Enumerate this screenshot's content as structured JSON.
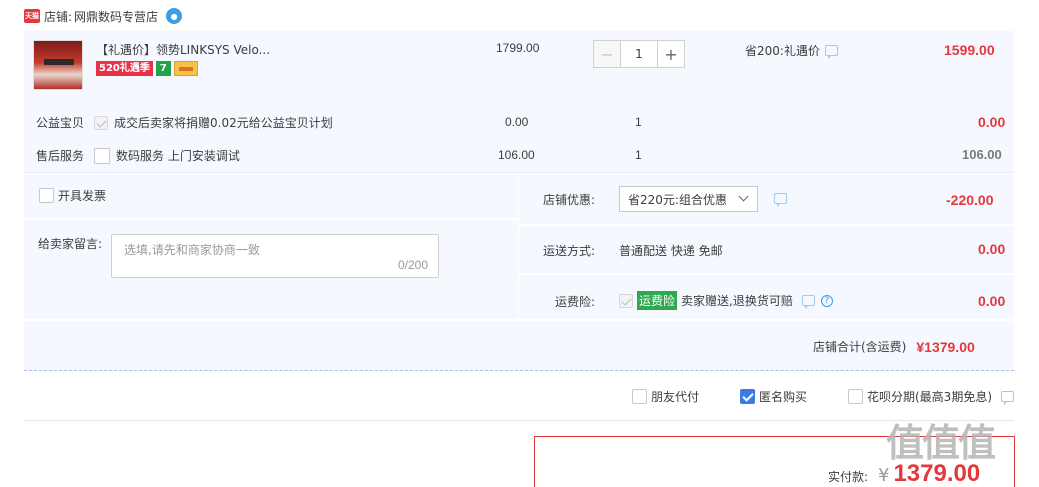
{
  "shop": {
    "platform_badge": "天猫",
    "label": "店铺:",
    "name": "网鼎数码专营店",
    "ww_icon": "wangwang-chat-icon"
  },
  "item": {
    "title": "【礼遇价】领势LINKSYS Velo...",
    "badge_520": "520礼遇季",
    "badge_7": "7",
    "unit_price": "1799.00",
    "quantity": "1",
    "promo": "省200:礼遇价",
    "total": "1599.00"
  },
  "charity": {
    "label": "公益宝贝",
    "desc": "成交后卖家将捐赠0.02元给公益宝贝计划",
    "price": "0.00",
    "qty": "1",
    "total": "0.00"
  },
  "service": {
    "label": "售后服务",
    "desc": "数码服务 上门安装调试",
    "price": "106.00",
    "qty": "1",
    "total": "106.00"
  },
  "invoice": {
    "label": "开具发票"
  },
  "message": {
    "label": "给卖家留言:",
    "placeholder": "选填,请先和商家协商一致",
    "count": "0/200"
  },
  "discount": {
    "label": "店铺优惠:",
    "selected": "省220元:组合优惠",
    "amount": "-220.00"
  },
  "shipping": {
    "label": "运送方式:",
    "value": "普通配送 快递 免邮",
    "amount": "0.00"
  },
  "insurance": {
    "label": "运费险:",
    "badge": "运费险",
    "desc": "卖家赠送,退换货可赔",
    "amount": "0.00"
  },
  "shop_total": {
    "label": "店铺合计(含运费)",
    "amount": "¥1379.00"
  },
  "options": {
    "friend_pay": "朋友代付",
    "anonymous": "匿名购买",
    "huabei": "花呗分期(最高3期免息)"
  },
  "pay": {
    "label": "实付款:",
    "currency": "¥",
    "amount": "1379.00"
  },
  "watermark": "值值值"
}
